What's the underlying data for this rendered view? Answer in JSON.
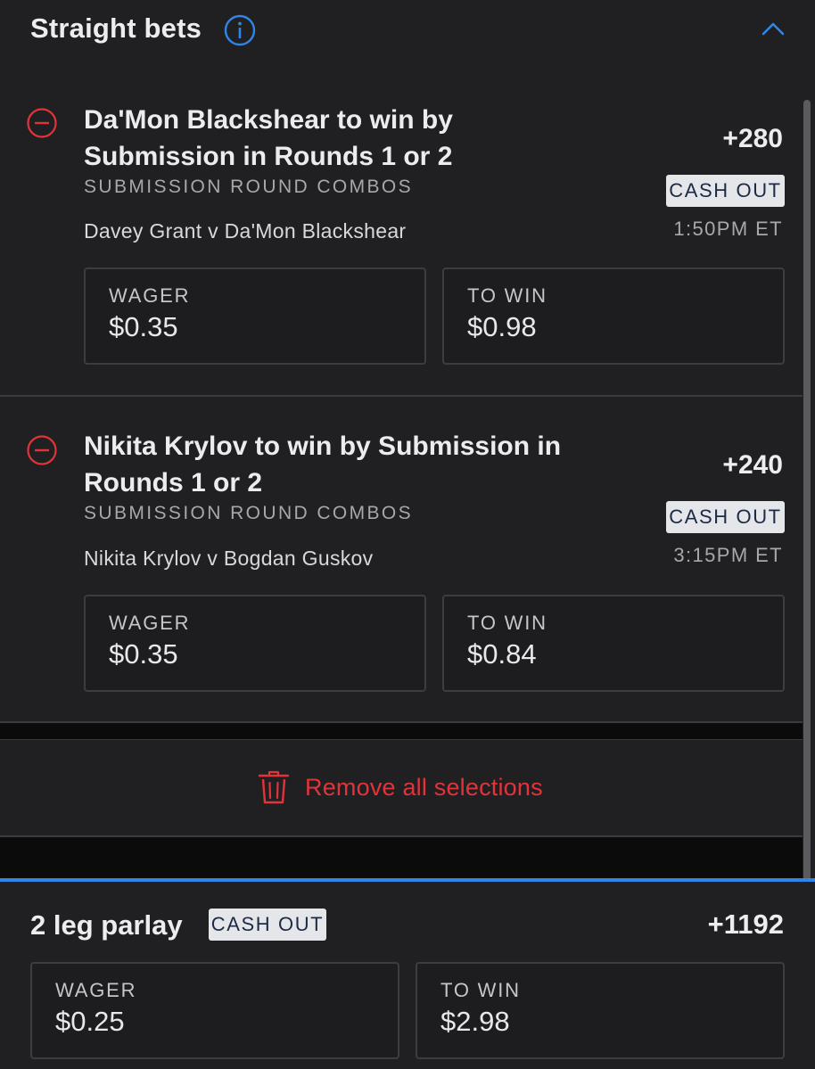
{
  "header": {
    "title": "Straight bets",
    "info_icon": "info-circle-icon",
    "collapse_icon": "chevron-up-icon",
    "accent_color": "#2f86e8"
  },
  "bets": [
    {
      "title": "Da'Mon Blackshear to win by Submission in Rounds 1 or 2",
      "market": "SUBMISSION ROUND COMBOS",
      "event": "Davey Grant v Da'Mon Blackshear",
      "odds": "+280",
      "cashout_label": "CASH OUT",
      "time": "1:50PM ET",
      "wager_label": "WAGER",
      "wager_value": "$0.35",
      "towin_label": "TO WIN",
      "towin_value": "$0.98"
    },
    {
      "title": "Nikita Krylov to win by Submission in Rounds 1 or 2",
      "market": "SUBMISSION ROUND COMBOS",
      "event": "Nikita Krylov v Bogdan Guskov",
      "odds": "+240",
      "cashout_label": "CASH OUT",
      "time": "3:15PM ET",
      "wager_label": "WAGER",
      "wager_value": "$0.35",
      "towin_label": "TO WIN",
      "towin_value": "$0.84"
    }
  ],
  "remove_all": {
    "label": "Remove all selections",
    "icon": "trash-icon",
    "color": "#e0343a"
  },
  "parlay": {
    "title": "2 leg parlay",
    "cashout_label": "CASH OUT",
    "odds": "+1192",
    "wager_label": "WAGER",
    "wager_value": "$0.25",
    "towin_label": "TO WIN",
    "towin_value": "$2.98"
  }
}
